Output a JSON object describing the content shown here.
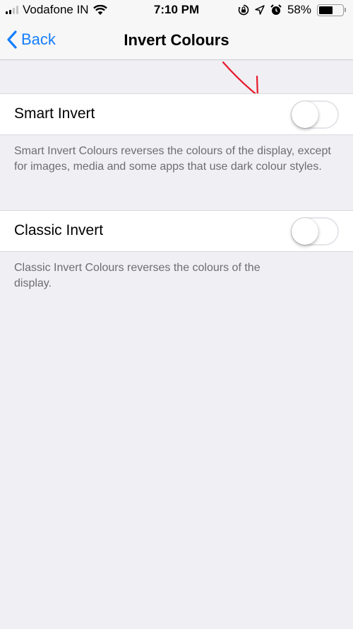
{
  "status_bar": {
    "carrier": "Vodafone IN",
    "signal_bars_filled": 2,
    "signal_bars_total": 4,
    "time": "7:10 PM",
    "battery_percent_label": "58%",
    "battery_level": 0.58,
    "icons": [
      "signal-icon",
      "wifi-icon",
      "orientation-lock-icon",
      "location-icon",
      "alarm-icon",
      "battery-icon"
    ]
  },
  "nav": {
    "back_label": "Back",
    "title": "Invert Colours"
  },
  "settings": [
    {
      "label": "Smart Invert",
      "enabled": false,
      "description": "Smart Invert Colours reverses the colours of the display, except for images, media and some apps that use dark colour styles."
    },
    {
      "label": "Classic Invert",
      "enabled": false,
      "description": "Classic Invert Colours reverses the colours of the display."
    }
  ],
  "colors": {
    "accent": "#147efb",
    "background": "#efeff4",
    "annotation": "#e8192c"
  }
}
